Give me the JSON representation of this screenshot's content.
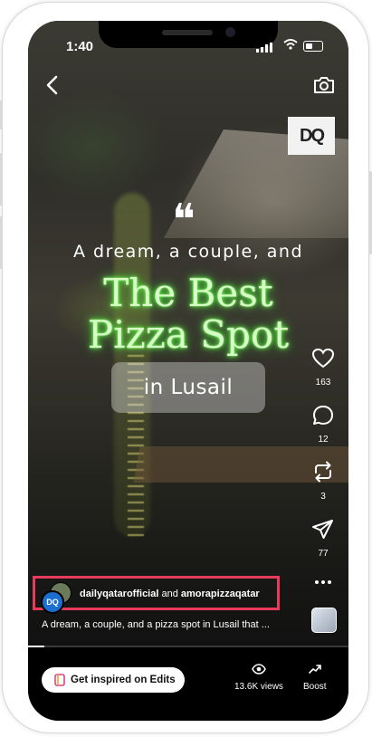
{
  "status_bar": {
    "time": "1:40"
  },
  "overlay": {
    "brand_logo": "DQ",
    "quote_mark": "❝",
    "tagline": "A dream, a couple, and",
    "headline_line1": "The Best",
    "headline_line2": "Pizza Spot",
    "location_badge": "in Lusail"
  },
  "actions": {
    "likes": "163",
    "comments": "12",
    "reposts": "3",
    "shares": "77"
  },
  "post": {
    "author1": "dailyqatarofficial",
    "connector": "and",
    "author2": "amorapizzaqatar",
    "avatar_initials": "DQ",
    "caption": "A dream, a couple, and a pizza spot in Lusail that ..."
  },
  "playback": {
    "progress_fraction": 0.05
  },
  "bottom_bar": {
    "edits_label": "Get inspired on Edits",
    "views": "13.6K views",
    "boost_label": "Boost"
  },
  "colors": {
    "highlight_border": "#e83a5a",
    "neon_text": "#d8ffc8",
    "neon_glow": "#6aff4a"
  }
}
